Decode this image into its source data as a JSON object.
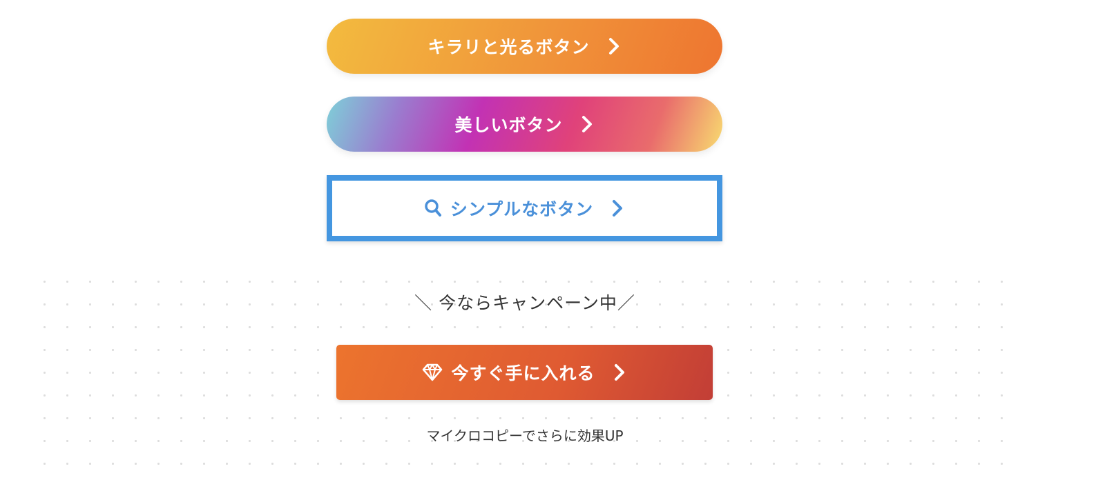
{
  "buttons": {
    "kirari": {
      "label": "キラリと光るボタン",
      "icon": "chevron-right-icon"
    },
    "beautiful": {
      "label": "美しいボタン",
      "icon": "chevron-right-icon"
    },
    "simple": {
      "label": "シンプルなボタン",
      "leading_icon": "search-icon",
      "icon": "chevron-right-icon",
      "color": "#4496e0"
    }
  },
  "campaign": {
    "banner": "＼ 今ならキャンペーン中／",
    "cta_label": "今すぐ手に入れる",
    "cta_leading_icon": "gem-icon",
    "cta_icon": "chevron-right-icon",
    "microcopy": "マイクロコピーでさらに効果UP"
  },
  "colors": {
    "orange_gradient": [
      "#f3bb3f",
      "#ee7530"
    ],
    "rainbow_gradient": [
      "#7ed0d8",
      "#c232b4",
      "#e0427a",
      "#f8dc70"
    ],
    "cta_gradient": [
      "#ec742e",
      "#c23e36"
    ]
  }
}
